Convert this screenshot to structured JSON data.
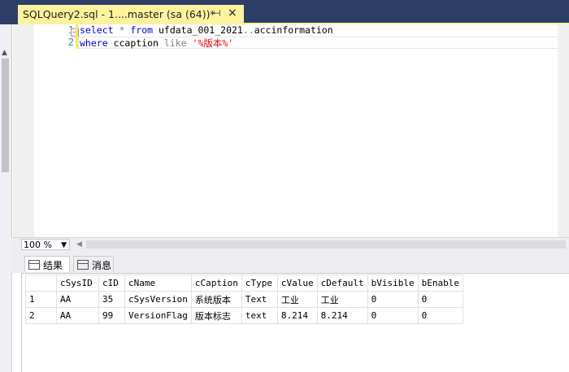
{
  "tab": {
    "title": "SQLQuery2.sql - 1....master (sa (64))*",
    "pin_glyph": "⊣",
    "close_glyph": "×"
  },
  "editor": {
    "lines": [
      {
        "num": "1",
        "tokens": [
          {
            "t": "select",
            "c": "kw"
          },
          {
            "t": " ",
            "c": ""
          },
          {
            "t": "*",
            "c": "op"
          },
          {
            "t": " ",
            "c": ""
          },
          {
            "t": "from",
            "c": "kw"
          },
          {
            "t": " ufdata_001_2021",
            "c": ""
          },
          {
            "t": "..",
            "c": "op"
          },
          {
            "t": "accinformation",
            "c": ""
          }
        ]
      },
      {
        "num": "2",
        "tokens": [
          {
            "t": "where",
            "c": "kw"
          },
          {
            "t": " ccaption ",
            "c": ""
          },
          {
            "t": "like",
            "c": "op"
          },
          {
            "t": " ",
            "c": ""
          },
          {
            "t": "'%版本%'",
            "c": "str"
          }
        ]
      }
    ]
  },
  "zoom": {
    "value": "100 %"
  },
  "results_tabs": {
    "results": "结果",
    "messages": "消息"
  },
  "grid": {
    "columns": [
      "cSysID",
      "cID",
      "cName",
      "cCaption",
      "cType",
      "cValue",
      "cDefault",
      "bVisible",
      "bEnable"
    ],
    "rows": [
      {
        "num": "1",
        "cells": [
          "AA",
          "35",
          "cSysVersion",
          "系统版本",
          "Text",
          "工业",
          "工业",
          "0",
          "0"
        ]
      },
      {
        "num": "2",
        "cells": [
          "AA",
          "99",
          "VersionFlag",
          "版本标志",
          "text",
          "8.214",
          "8.214",
          "0",
          "0"
        ]
      }
    ]
  }
}
